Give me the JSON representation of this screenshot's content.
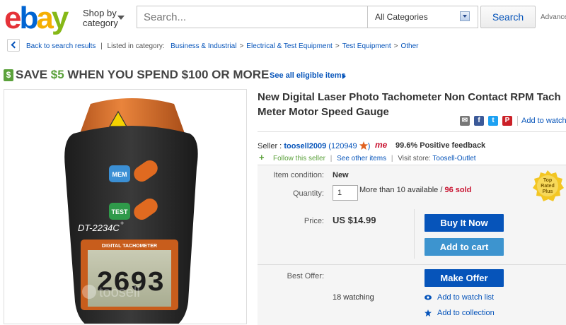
{
  "header": {
    "logo_letters": [
      "e",
      "b",
      "a",
      "y"
    ],
    "logo_colors": [
      "#e53238",
      "#0064d2",
      "#f5af02",
      "#86b817"
    ],
    "shop_by_category": "Shop by category",
    "search_placeholder": "Search...",
    "category_selected": "All Categories",
    "search_button": "Search",
    "advanced": "Advanced"
  },
  "breadcrumb": {
    "back": "Back to search results",
    "listed_in": "Listed in category:",
    "categories": [
      "Business & Industrial",
      "Electrical & Test Equipment",
      "Test Equipment",
      "Other"
    ]
  },
  "promo": {
    "prefix": "SAVE ",
    "amount": "$5",
    "suffix": " WHEN YOU SPEND $100 OR MORE",
    "link": "See all eligible items"
  },
  "product_image": {
    "model_label": "DT-2234C",
    "model_sup": "+",
    "mem_label": "MEM",
    "test_label": "TEST",
    "display_title": "DIGITAL TACHOMETER",
    "display_value": "2693",
    "watermark": "toosell"
  },
  "title": {
    "line1": "New Digital Laser Photo Tachometer Non Contact RPM Tach",
    "line2": "Meter Motor Speed Gauge"
  },
  "share": {
    "add_to_watch": "Add to watch list"
  },
  "seller": {
    "label": "Seller :",
    "name": "toosell2009",
    "score": "(120949",
    "me": "me",
    "feedback": "99.6% Positive feedback",
    "follow": "Follow this seller",
    "see_other": "See other items",
    "visit_label": "Visit store:",
    "store": "Toosell-Outlet"
  },
  "details": {
    "condition_label": "Item condition:",
    "condition_value": "New",
    "quantity_label": "Quantity:",
    "quantity_value": "1",
    "available": "More than 10 available /",
    "sold": "96 sold",
    "price_label": "Price:",
    "price_value": "US $14.99",
    "buy_now": "Buy It Now",
    "add_to_cart": "Add to cart",
    "best_offer_label": "Best Offer:",
    "make_offer": "Make Offer",
    "watching": "18 watching",
    "add_watch": "Add to watch list",
    "add_collection": "Add to collection",
    "top_rated": [
      "Top",
      "Rated",
      "Plus"
    ]
  },
  "colors": {
    "link": "#0654ba",
    "buy_now": "#0654ba",
    "add_to_cart": "#3d94cf",
    "make_offer": "#0654ba",
    "promo_green": "#5ba13b",
    "sold_red": "#c8102e"
  }
}
